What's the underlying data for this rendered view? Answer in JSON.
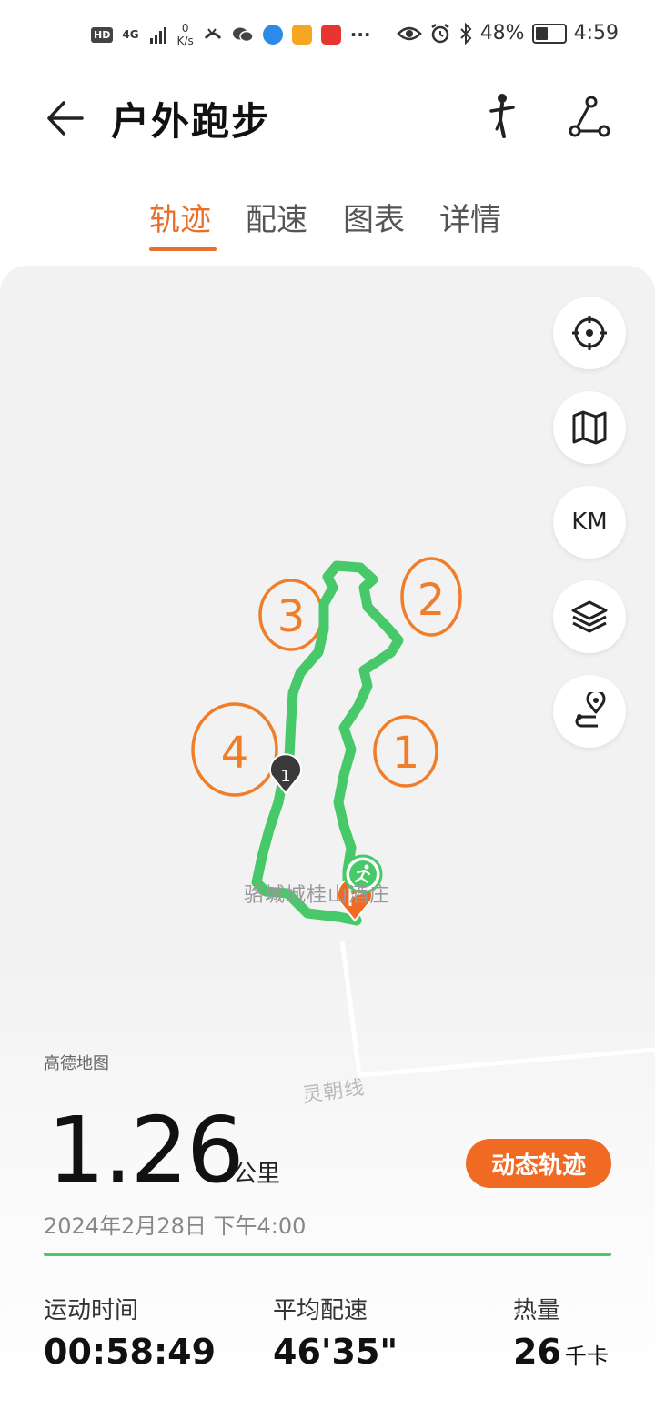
{
  "status_bar": {
    "hd": "HD",
    "network": "4G",
    "speed_value": "0",
    "speed_unit": "K/s",
    "more": "···",
    "battery_percent": "48%",
    "battery_level": 0.48,
    "time": "4:59"
  },
  "header": {
    "title": "户外跑步"
  },
  "tabs": [
    {
      "label": "轨迹",
      "active": true
    },
    {
      "label": "配速",
      "active": false
    },
    {
      "label": "图表",
      "active": false
    },
    {
      "label": "详情",
      "active": false
    }
  ],
  "map": {
    "controls": {
      "locate": "locate-icon",
      "map_type": "map-icon",
      "km_label": "KM",
      "layers": "layers-icon",
      "route": "route-pin-icon"
    },
    "km_marker": "1",
    "place_label": "骆城城桂山酒庄",
    "road_label": "灵朝线",
    "annotations": [
      "1",
      "2",
      "3",
      "4"
    ],
    "route_color": "#47c96a",
    "annotation_color": "#f07d2a",
    "source": "高德地图"
  },
  "summary": {
    "distance": "1.26",
    "distance_unit": "公里",
    "dynamic_track_label": "动态轨迹",
    "datetime": "2024年2月28日 下午4:00",
    "stats": [
      {
        "label": "运动时间",
        "value": "00:58:49",
        "unit": ""
      },
      {
        "label": "平均配速",
        "value": "46'35\"",
        "unit": ""
      },
      {
        "label": "热量",
        "value": "26",
        "unit": "千卡"
      }
    ]
  },
  "colors": {
    "accent": "#e8702a",
    "button": "#f06a24",
    "route": "#47c96a"
  }
}
